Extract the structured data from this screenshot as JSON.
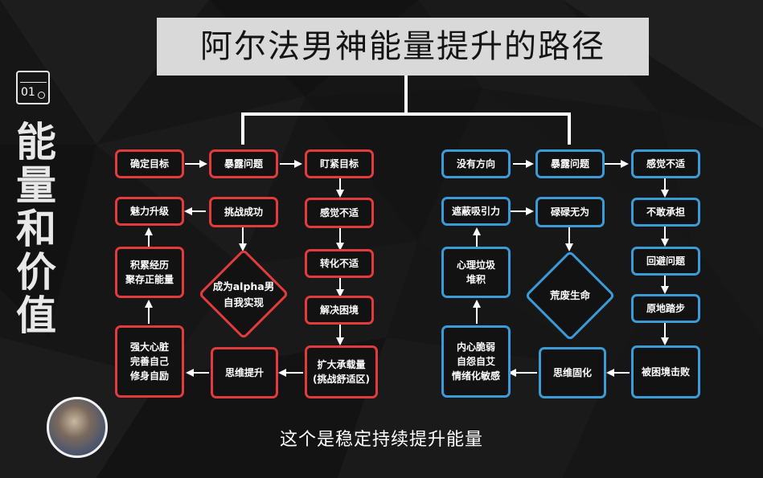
{
  "title": "阿尔法男神能量提升的路径",
  "side_title": "能量和价值",
  "episode_number": "01",
  "subtitle": "这个是稳定持续提升能量",
  "colors": {
    "positive": "#e23b3b",
    "negative": "#3c9ad6",
    "title_bg": "#d9d9d9"
  },
  "left": {
    "nodes": {
      "n1": "确定目标",
      "n2": "暴露问题",
      "n3": "盯紧目标",
      "n4": "感觉不适",
      "n5": "转化不适",
      "n6": "解决困境",
      "n7": "扩大承载量\n(挑战舒适区)",
      "n8": "思维提升",
      "n9": "强大心脏\n完善自己\n修身自励",
      "n10": "积累经历\n聚存正能量",
      "n11": "魅力升级",
      "n12": "挑战成功",
      "d": "成为alpha男\n自我实现"
    }
  },
  "right": {
    "nodes": {
      "n1": "没有方向",
      "n2": "暴露问题",
      "n3": "感觉不适",
      "n4": "不敢承担",
      "n5": "回避问题",
      "n6": "原地踏步",
      "n7": "被困境击败",
      "n8": "思维固化",
      "n9": "内心脆弱\n自怨自艾\n情绪化敏感",
      "n10": "心理垃圾\n堆积",
      "n11": "遮蔽吸引力",
      "n12": "碌碌无为",
      "d": "荒废生命"
    }
  }
}
